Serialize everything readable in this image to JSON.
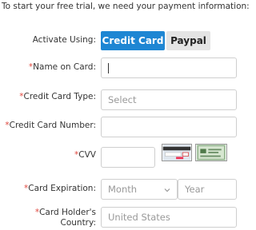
{
  "intro": "To start your free trial, we need your payment information:",
  "activate": {
    "label": "Activate Using:",
    "options": [
      "Credit Card",
      "Paypal"
    ],
    "selected": "Credit Card"
  },
  "fields": {
    "name_label": "Name on Card:",
    "name_value": "",
    "card_type_label": "Credit Card Type:",
    "card_type_placeholder": "Select",
    "card_number_label": "Credit Card Number:",
    "cvv_label": "CVV",
    "expiration_label": "Card Expiration:",
    "month_placeholder": "Month",
    "year_placeholder": "Year",
    "country_label_1": "Card Holder's",
    "country_label_2": "Country:",
    "country_value": "United States"
  },
  "required_marker": "*",
  "colors": {
    "accent": "#1e86d3",
    "required": "#e0483e",
    "button_inactive": "#e4e4e4"
  }
}
